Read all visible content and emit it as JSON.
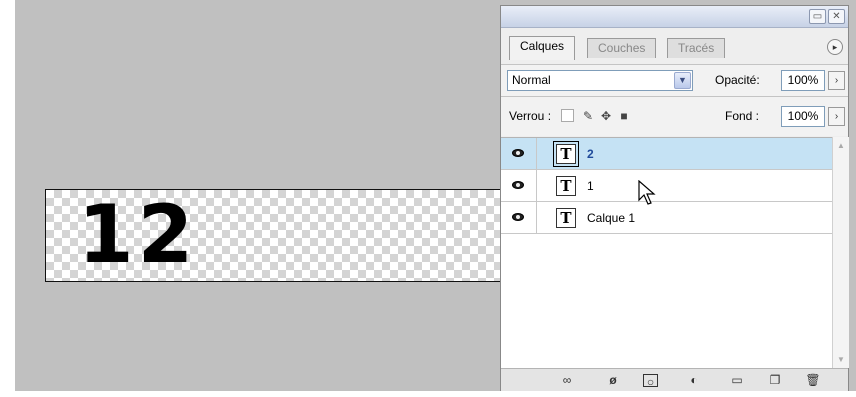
{
  "canvas": {
    "text": "12"
  },
  "panel": {
    "titlebar_buttons": {
      "minimize": "▭",
      "close": "✕"
    },
    "tabs": [
      {
        "label": "Calques",
        "active": true
      },
      {
        "label": "Couches",
        "active": false
      },
      {
        "label": "Tracés",
        "active": false
      }
    ],
    "menu_icon": "▸",
    "blend_mode": "Normal",
    "opacity_label": "Opacité:",
    "opacity_value": "100%",
    "lock_label": "Verrou :",
    "fill_label": "Fond :",
    "fill_value": "100%",
    "layers": [
      {
        "name": "2",
        "type": "T",
        "visible": true,
        "selected": true
      },
      {
        "name": "1",
        "type": "T",
        "visible": true,
        "selected": false
      },
      {
        "name": "Calque 1",
        "type": "T",
        "visible": true,
        "selected": false
      }
    ]
  },
  "icons": {
    "lock_transparent": "lock-transparent-pixels-icon",
    "lock_paint": "brush-icon",
    "lock_move": "move-icon",
    "lock_all": "lock-icon",
    "bottom": [
      "link-icon",
      "fx-icon",
      "mask-icon",
      "adjustment-icon",
      "folder-icon",
      "new-layer-icon",
      "trash-icon"
    ]
  },
  "colors": {
    "selected_row": "#c5e2f4",
    "workspace": "#c0c0c0",
    "panel": "#eeeeee"
  }
}
